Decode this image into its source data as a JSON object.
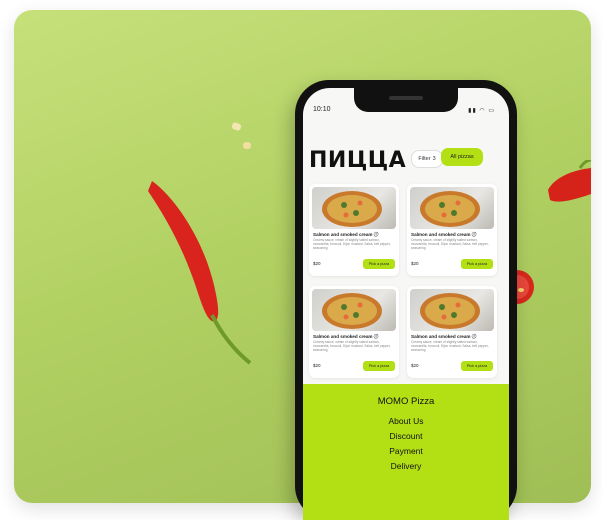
{
  "statusbar": {
    "time": "10:10"
  },
  "page": {
    "title": "ПИЦЦА"
  },
  "filter": {
    "label": "Filter",
    "count": "3"
  },
  "all_pizzas": {
    "label": "All pizzas"
  },
  "products": [
    {
      "name": "Salmon and smoked cream",
      "desc": "Creamy sauce, cream of slightly salted salmon, mozzarella, broccoli, Dijon mustard, Salsa, bell pepper, seasoning",
      "price": "$20",
      "button": "Pick a pizza"
    },
    {
      "name": "Salmon and smoked cream",
      "desc": "Creamy sauce, cream of slightly salted salmon, mozzarella, broccoli, Dijon mustard, Salsa, bell pepper, seasoning",
      "price": "$20",
      "button": "Pick a pizza"
    },
    {
      "name": "Salmon and smoked cream",
      "desc": "Creamy sauce, cream of slightly salted salmon, mozzarella, broccoli, Dijon mustard, Salsa, bell pepper, seasoning",
      "price": "$20",
      "button": "Pick a pizza"
    },
    {
      "name": "Salmon and smoked cream",
      "desc": "Creamy sauce, cream of slightly salted salmon, mozzarella, broccoli, Dijon mustard, Salsa, bell pepper, seasoning",
      "price": "$20",
      "button": "Pick a pizza"
    }
  ],
  "footer": {
    "brand": "MOMO Pizza",
    "links": [
      "About Us",
      "Discount",
      "Payment",
      "Delivery"
    ]
  },
  "colors": {
    "accent": "#b3e015",
    "background": "#b8d66a"
  },
  "icons": {
    "info": "info-icon",
    "filter": "sliders-icon"
  }
}
